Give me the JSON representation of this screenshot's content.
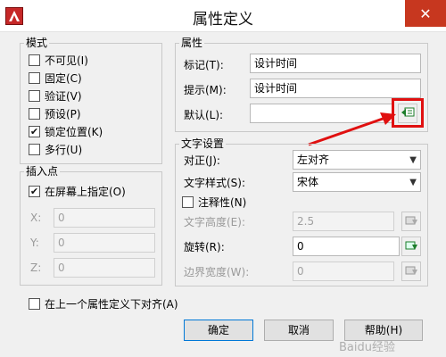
{
  "window": {
    "title": "属性定义",
    "close_symbol": "✕"
  },
  "mode": {
    "legend": "模式",
    "options": [
      {
        "label": "不可见(I)",
        "checked": false
      },
      {
        "label": "固定(C)",
        "checked": false
      },
      {
        "label": "验证(V)",
        "checked": false
      },
      {
        "label": "预设(P)",
        "checked": false
      },
      {
        "label": "锁定位置(K)",
        "checked": true
      },
      {
        "label": "多行(U)",
        "checked": false
      }
    ]
  },
  "attribute": {
    "legend": "属性",
    "tag_label": "标记(T):",
    "tag_value": "设计时间",
    "prompt_label": "提示(M):",
    "prompt_value": "设计时间",
    "default_label": "默认(L):",
    "default_value": ""
  },
  "insertion": {
    "legend": "插入点",
    "specify_on_screen": {
      "label": "在屏幕上指定(O)",
      "checked": true
    },
    "x_label": "X:",
    "x_value": "0",
    "y_label": "Y:",
    "y_value": "0",
    "z_label": "Z:",
    "z_value": "0"
  },
  "text_settings": {
    "legend": "文字设置",
    "justify_label": "对正(J):",
    "justify_value": "左对齐",
    "style_label": "文字样式(S):",
    "style_value": "宋体",
    "annotative": {
      "label": "注释性(N)",
      "checked": false
    },
    "height_label": "文字高度(E):",
    "height_value": "2.5",
    "rotation_label": "旋转(R):",
    "rotation_value": "0",
    "boundary_label": "边界宽度(W):",
    "boundary_value": "0"
  },
  "align_below": {
    "label": "在上一个属性定义下对齐(A)",
    "checked": false
  },
  "buttons": {
    "ok": "确定",
    "cancel": "取消",
    "help": "帮助(H)"
  },
  "annotation": {
    "highlight_color": "#e01010",
    "arrow_color": "#e01010"
  },
  "watermark": "Baidu经验"
}
